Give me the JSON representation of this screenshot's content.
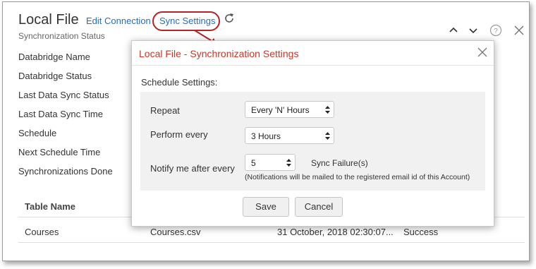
{
  "header": {
    "title": "Local File",
    "edit_link": "Edit Connection",
    "sync_link": "Sync Settings",
    "subtitle": "Synchronization Status"
  },
  "details": {
    "labels": [
      "Databridge Name",
      "Databridge Status",
      "Last Data Sync Status",
      "Last Data Sync Time",
      "Schedule",
      "Next Schedule Time",
      "Synchronizations Done"
    ]
  },
  "table": {
    "column_header": "Table Name",
    "row": {
      "name": "Courses",
      "file": "Courses.csv",
      "time": "31 October, 2018 02:30:07...",
      "status": "Success"
    }
  },
  "dialog": {
    "title": "Local File - Synchronization Settings",
    "schedule_label": "Schedule Settings:",
    "repeat_label": "Repeat",
    "repeat_value": "Every 'N' Hours",
    "perform_label": "Perform every",
    "perform_value": "3 Hours",
    "notify_label": "Notify me after every",
    "notify_value": "5",
    "sync_failure": "Sync Failure(s)",
    "note": "(Notifications will be mailed to the registered email id of this Account)",
    "save": "Save",
    "cancel": "Cancel"
  },
  "colors": {
    "link": "#1f6fc5",
    "dialog_title": "#c0392b",
    "annotation": "#b5232a"
  },
  "icons": [
    "refresh-icon",
    "chevron-up-icon",
    "chevron-down-icon",
    "help-icon",
    "close-icon",
    "select-arrows-icon"
  ]
}
